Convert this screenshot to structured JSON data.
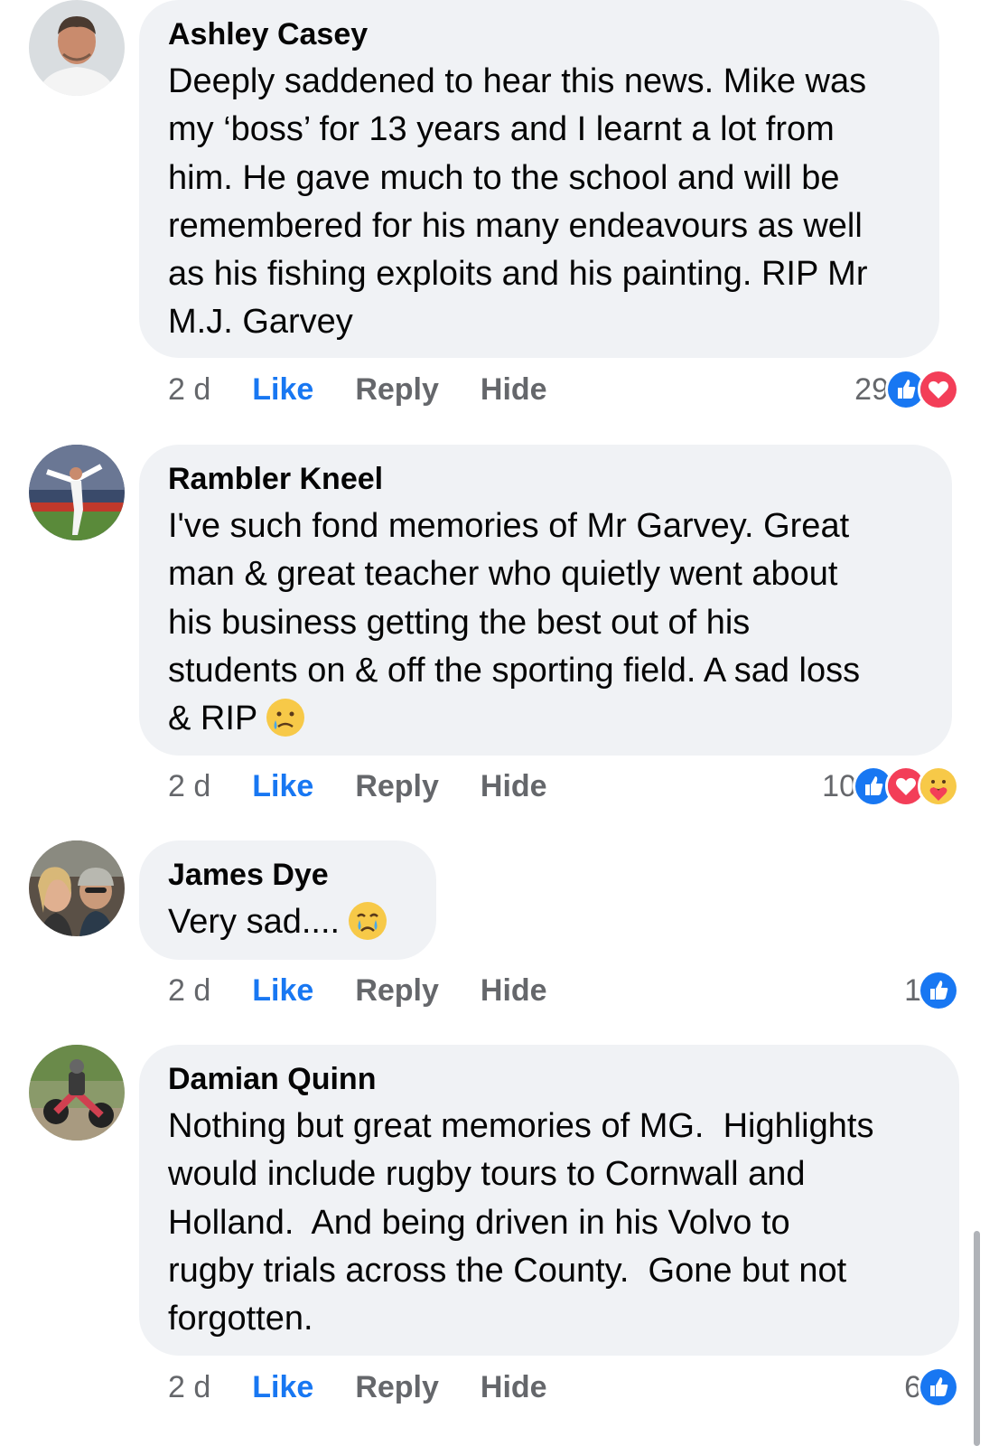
{
  "comments": [
    {
      "author": "Ashley Casey",
      "text": "Deeply saddened to hear this news. Mike was\nmy ‘boss’ for 13 years and I learnt a lot from\nhim. He gave much to the school and will be\nremembered for his many endeavours as well\nas his fishing exploits and his painting. RIP Mr\nM.J. Garvey",
      "time": "2 d",
      "like": "Like",
      "reply": "Reply",
      "hide": "Hide",
      "reaction_count": "29",
      "reactions": [
        "like-icon",
        "love-icon"
      ]
    },
    {
      "author": "Rambler Kneel",
      "text": "I've such fond memories of Mr Garvey. Great\nman & great teacher who quietly went about\nhis business getting the best out of his\nstudents on & off the sporting field. A sad loss\n& RIP",
      "emoji": "sad-tear-emoji",
      "time": "2 d",
      "like": "Like",
      "reply": "Reply",
      "hide": "Hide",
      "reaction_count": "10",
      "reactions": [
        "like-icon",
        "love-icon",
        "care-icon"
      ]
    },
    {
      "author": "James Dye",
      "text": "Very sad....",
      "emoji": "crying-emoji",
      "time": "2 d",
      "like": "Like",
      "reply": "Reply",
      "hide": "Hide",
      "reaction_count": "1",
      "reactions": [
        "like-icon"
      ]
    },
    {
      "author": "Damian Quinn",
      "text": "Nothing but great memories of MG.  Highlights\nwould include rugby tours to Cornwall and\nHolland.  And being driven in his Volvo to\nrugby trials across the County.  Gone but not\nforgotten.",
      "time": "2 d",
      "like": "Like",
      "reply": "Reply",
      "hide": "Hide",
      "reaction_count": "6",
      "reactions": [
        "like-icon"
      ]
    }
  ],
  "colors": {
    "bubble": "#f0f2f5",
    "like_blue": "#1877f2",
    "love_red": "#f33e58",
    "muted": "#65676b"
  }
}
